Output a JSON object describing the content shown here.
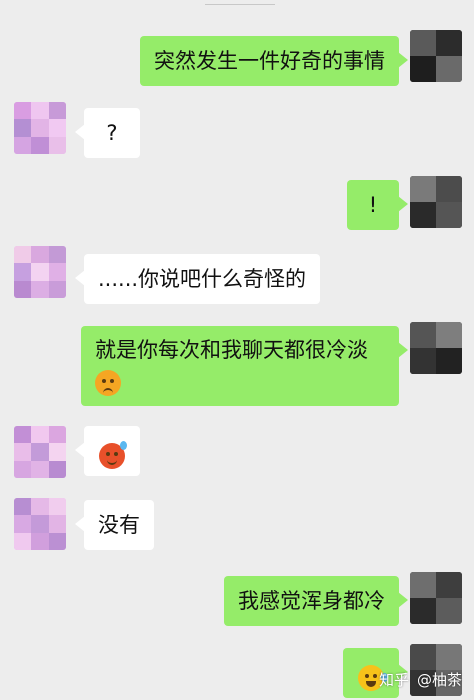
{
  "messages": [
    {
      "from": "me",
      "text": "突然发生一件好奇的事情"
    },
    {
      "from": "friend",
      "text": "?"
    },
    {
      "from": "me",
      "text": "!"
    },
    {
      "from": "friend",
      "text": "......你说吧什么奇怪的"
    },
    {
      "from": "me",
      "text": "就是你每次和我聊天都很冷淡",
      "emoji": "worried-face-emoji"
    },
    {
      "from": "friend",
      "emoji": "cold-sweat-face-emoji"
    },
    {
      "from": "friend",
      "text": "没有"
    },
    {
      "from": "me",
      "text": "我感觉浑身都冷"
    },
    {
      "from": "me",
      "emoji": "crying-laughing-emoji"
    }
  ],
  "watermark": {
    "platform": "知乎",
    "user": "@柚茶"
  },
  "colors": {
    "background": "#ededed",
    "sent_bubble": "#95ec69",
    "received_bubble": "#ffffff"
  }
}
